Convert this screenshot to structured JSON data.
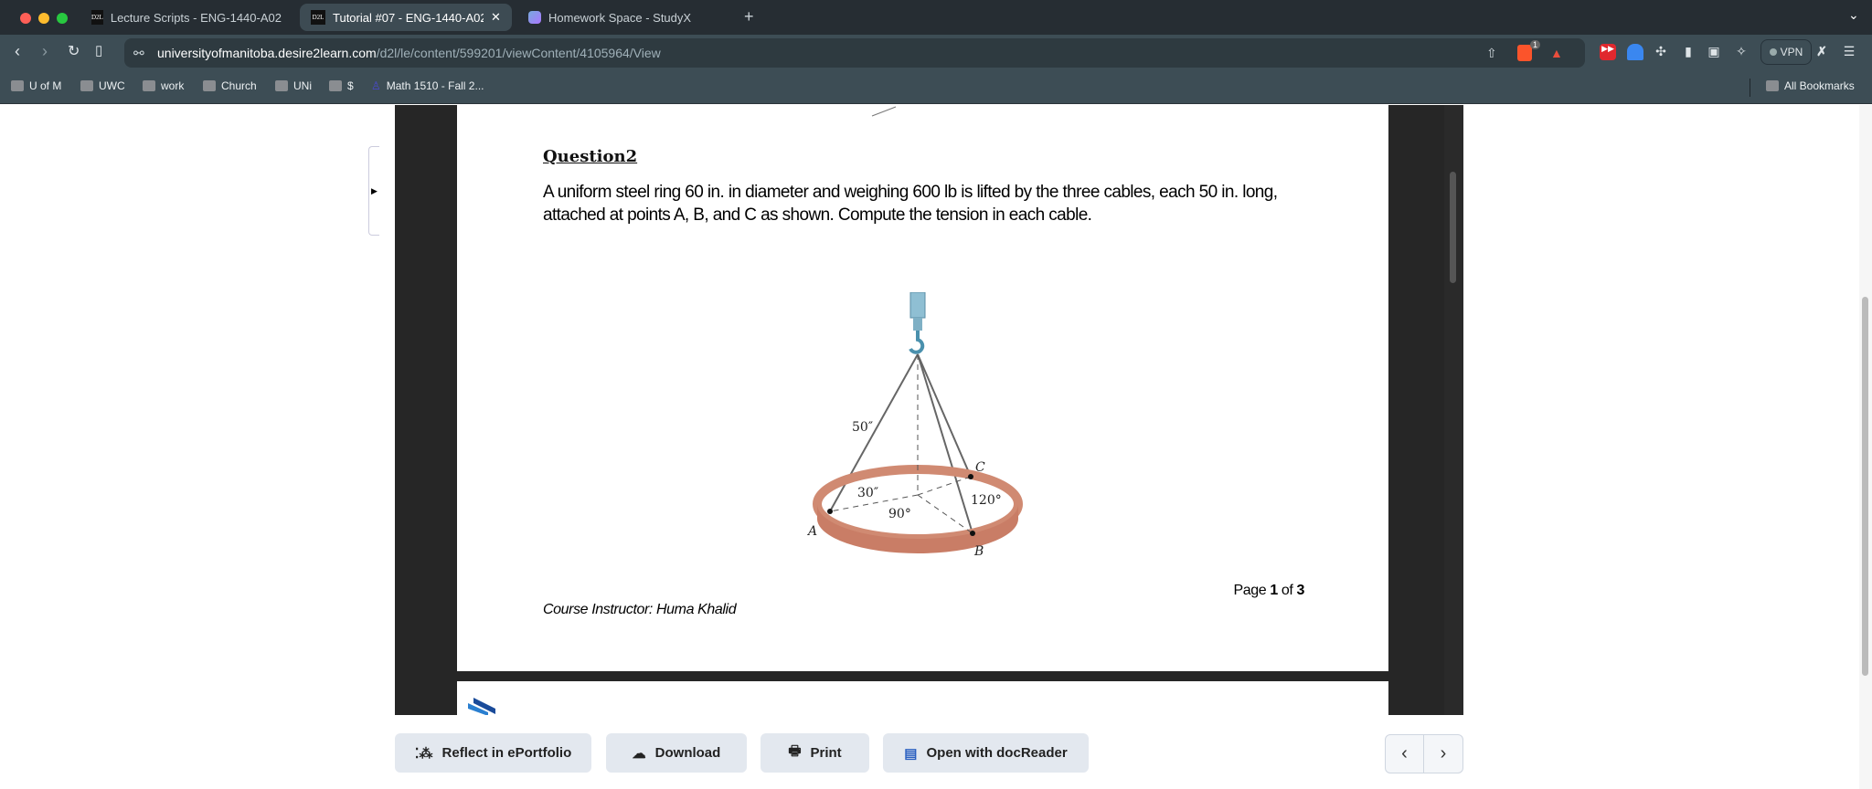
{
  "browser": {
    "tabs": [
      {
        "label": "Lecture Scripts - ENG-1440-A02",
        "favicon": "D2L",
        "active": false
      },
      {
        "label": "Tutorial #07 - ENG-1440-A02",
        "favicon": "D2L",
        "active": true
      },
      {
        "label": "Homework Space - StudyX",
        "favicon": "studyx-icon",
        "active": false
      }
    ],
    "url_domain": "universityofmanitoba.desire2learn.com",
    "url_path": "/d2l/le/content/599201/viewContent/4105964/View",
    "shield_badge": "1",
    "vpn_label": "VPN",
    "bookmarks": [
      "U of M",
      "UWC",
      "work",
      "Church",
      "UNi",
      "$",
      "Math 1510 - Fall 2..."
    ],
    "all_bookmarks": "All Bookmarks"
  },
  "document": {
    "question_title": "Question2",
    "question_text": "A uniform steel ring 60 in. in diameter and weighing 600 lb is lifted by the three cables, each 50 in. long, attached at points A, B, and C as shown. Compute the tension in each cable.",
    "figure_labels": {
      "cable": "50″",
      "radius": "30″",
      "angle_ab": "90°",
      "angle_bc": "120°",
      "a": "A",
      "b": "B",
      "c": "C"
    },
    "page_prefix": "Page ",
    "page_current": "1",
    "page_of": " of ",
    "page_total": "3",
    "instructor": "Course Instructor: Huma Khalid"
  },
  "actions": {
    "reflect": "Reflect in ePortfolio",
    "download": "Download",
    "print": "Print",
    "docreader": "Open with docReader"
  },
  "colors": {
    "ring": "#d98f78",
    "hook": "#6fa8c0",
    "tabbar": "#262d33",
    "toolbar": "#3d4d55",
    "button": "#e3e8ef"
  }
}
